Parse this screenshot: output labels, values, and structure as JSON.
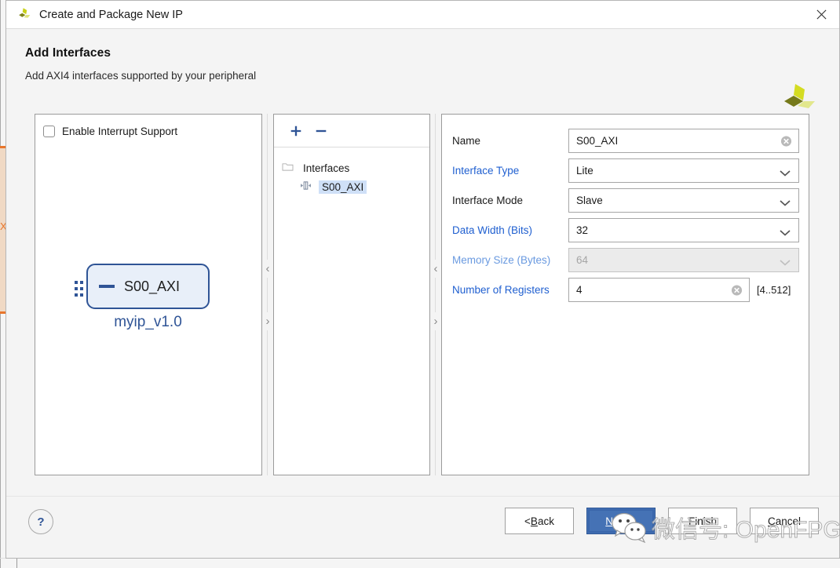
{
  "window": {
    "title": "Create and Package New IP",
    "logo_icon": "xilinx-logo-icon",
    "close_icon": "close-icon"
  },
  "header": {
    "title": "Add Interfaces",
    "subtitle": "Add AXI4 interfaces supported by your peripheral",
    "logo_icon": "xilinx-logo-icon"
  },
  "left_panel": {
    "interrupt_checkbox": {
      "label": "Enable Interrupt Support",
      "checked": false
    },
    "diagram": {
      "port_label": "S00_AXI",
      "module_name": "myip_v1.0",
      "block_fill": "#e8eff9",
      "block_border": "#2f5496",
      "text_color": "#2f5496"
    }
  },
  "tree_panel": {
    "toolbar": {
      "add_icon": "plus-icon",
      "remove_icon": "minus-icon",
      "add_label": "+",
      "remove_label": "−"
    },
    "root": {
      "label": "Interfaces",
      "icon": "folder-icon"
    },
    "items": [
      {
        "label": "S00_AXI",
        "icon": "bus-interface-icon",
        "selected": true
      }
    ],
    "selection_color": "#cfe0f7"
  },
  "properties": [
    {
      "label": "Name",
      "label_color": "black",
      "value": "S00_AXI",
      "kind": "text",
      "clearable": true,
      "disabled": false
    },
    {
      "label": "Interface Type",
      "label_color": "blue",
      "value": "Lite",
      "kind": "combo",
      "clearable": false,
      "disabled": false
    },
    {
      "label": "Interface Mode",
      "label_color": "black",
      "value": "Slave",
      "kind": "combo",
      "clearable": false,
      "disabled": false
    },
    {
      "label": "Data Width (Bits)",
      "label_color": "blue",
      "value": "32",
      "kind": "combo",
      "clearable": false,
      "disabled": false
    },
    {
      "label": "Memory Size (Bytes)",
      "label_color": "blue",
      "value": "64",
      "kind": "combo",
      "clearable": false,
      "disabled": true
    },
    {
      "label": "Number of Registers",
      "label_color": "blue",
      "value": "4",
      "kind": "text",
      "clearable": true,
      "disabled": false,
      "hint": "[4..512]"
    }
  ],
  "splitters": {
    "collapse_left_icon": "chevron-left-icon",
    "collapse_right_icon": "chevron-right-icon",
    "left_glyph": "‹",
    "right_glyph": "›"
  },
  "footer": {
    "help_label": "?",
    "buttons": [
      {
        "name": "back",
        "prefix": "< ",
        "mnemonic": "B",
        "rest": "ack",
        "primary": false
      },
      {
        "name": "next",
        "prefix": "",
        "mnemonic": "N",
        "rest": "ext >",
        "primary": true
      },
      {
        "name": "finish",
        "prefix": "",
        "mnemonic": "F",
        "rest": "inish",
        "primary": false
      },
      {
        "name": "cancel",
        "prefix": "",
        "mnemonic": "C",
        "rest": "ancel",
        "primary": false
      }
    ]
  },
  "watermark": {
    "text": "微信号: OpenFPGA",
    "logo_icon": "wechat-icon"
  },
  "colors": {
    "accent_blue": "#2f5496",
    "link_blue": "#1f5fd0",
    "primary_button": "#4572b5",
    "dialog_bg": "#f4f4f4",
    "panel_bg": "#ffffff",
    "bg_window_orange": "#e8762c"
  }
}
